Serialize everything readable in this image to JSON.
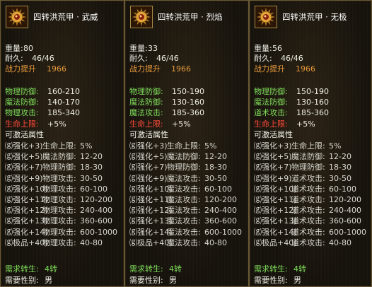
{
  "panels": [
    {
      "name": "四转洪荒甲 · 武威",
      "weight_label": "重量:",
      "weight": "80",
      "durability_label": "耐久:",
      "durability": "46/46",
      "power_label": "战力提升",
      "power": "1966",
      "stats": [
        {
          "label": "物理防御:",
          "value": "160-210"
        },
        {
          "label": "魔法防御:",
          "value": "140-170"
        },
        {
          "label": "物理攻击:",
          "value": "185-340"
        }
      ],
      "hp_label": "生命上限:",
      "hp_value": "+5%",
      "activate_title": "可激活属性",
      "activate": [
        {
          "level": "⒢强化+3)",
          "attr": "生命上限:",
          "value": "5%"
        },
        {
          "level": "⒢强化+5)",
          "attr": "魔法防御:",
          "value": "12-20"
        },
        {
          "level": "⒢强化+7)",
          "attr": "物理防御:",
          "value": "18-30"
        },
        {
          "level": "⒢强化+9)",
          "attr": "物理攻击:",
          "value": "30-50"
        },
        {
          "level": "⒢强化+10)",
          "attr": "物理攻击:",
          "value": "60-100"
        },
        {
          "level": "⒢强化+11)",
          "attr": "物理攻击:",
          "value": "120-200"
        },
        {
          "level": "⒢强化+12)",
          "attr": "物理攻击:",
          "value": "240-400"
        },
        {
          "level": "⒢强化+13)",
          "attr": "物理攻击:",
          "value": "360-600"
        },
        {
          "level": "⒢强化+14)",
          "attr": "物理攻击:",
          "value": "600-1000"
        },
        {
          "level": "⒢极品+40)",
          "attr": "物理攻击:",
          "value": "40-80"
        }
      ],
      "req_rebirth_label": "需求转生:",
      "req_rebirth": "4转",
      "req_gender_label": "需要性别:",
      "req_gender": "男"
    },
    {
      "name": "四转洪荒甲 · 烈焰",
      "weight_label": "重量:",
      "weight": "33",
      "durability_label": "耐久:",
      "durability": "46/46",
      "power_label": "战力提升",
      "power": "1966",
      "stats": [
        {
          "label": "物理防御:",
          "value": "150-190"
        },
        {
          "label": "魔法防御:",
          "value": "130-160"
        },
        {
          "label": "魔法攻击:",
          "value": "185-360"
        }
      ],
      "hp_label": "生命上限:",
      "hp_value": "+5%",
      "activate_title": "可激活属性",
      "activate": [
        {
          "level": "⒢强化+3)",
          "attr": "生命上限:",
          "value": "5%"
        },
        {
          "level": "⒢强化+5)",
          "attr": "魔法防御:",
          "value": "12-20"
        },
        {
          "level": "⒢强化+7)",
          "attr": "物理防御:",
          "value": "18-30"
        },
        {
          "level": "⒢强化+9)",
          "attr": "魔法攻击:",
          "value": "30-50"
        },
        {
          "level": "⒢强化+10)",
          "attr": "魔法攻击:",
          "value": "60-100"
        },
        {
          "level": "⒢强化+11)",
          "attr": "魔法攻击:",
          "value": "120-200"
        },
        {
          "level": "⒢强化+12)",
          "attr": "魔法攻击:",
          "value": "240-400"
        },
        {
          "level": "⒢强化+13)",
          "attr": "魔法攻击:",
          "value": "360-600"
        },
        {
          "level": "⒢强化+14)",
          "attr": "魔法攻击:",
          "value": "600-1000"
        },
        {
          "level": "⒢极品+40)",
          "attr": "魔法攻击:",
          "value": "40-80"
        }
      ],
      "req_rebirth_label": "需求转生:",
      "req_rebirth": "4转",
      "req_gender_label": "需要性别:",
      "req_gender": "男"
    },
    {
      "name": "四转洪荒甲 · 无极",
      "weight_label": "重量:",
      "weight": "56",
      "durability_label": "耐久:",
      "durability": "46/46",
      "power_label": "战力提升",
      "power": "1966",
      "stats": [
        {
          "label": "物理防御:",
          "value": "150-190"
        },
        {
          "label": "魔法防御:",
          "value": "130-160"
        },
        {
          "label": "道术攻击:",
          "value": "185-360"
        }
      ],
      "hp_label": "生命上限:",
      "hp_value": "+5%",
      "activate_title": "可激活属性",
      "activate": [
        {
          "level": "⒢强化+3)",
          "attr": "生命上限:",
          "value": "5%"
        },
        {
          "level": "⒢强化+5)",
          "attr": "魔法防御:",
          "value": "12-20"
        },
        {
          "level": "⒢强化+7)",
          "attr": "物理防御:",
          "value": "18-30"
        },
        {
          "level": "⒢强化+9)",
          "attr": "道术攻击:",
          "value": "30-50"
        },
        {
          "level": "⒢强化+10)",
          "attr": "道术攻击:",
          "value": "60-100"
        },
        {
          "level": "⒢强化+11)",
          "attr": "道术攻击:",
          "value": "120-200"
        },
        {
          "level": "⒢强化+12)",
          "attr": "道术攻击:",
          "value": "240-400"
        },
        {
          "level": "⒢强化+13)",
          "attr": "道术攻击:",
          "value": "360-600"
        },
        {
          "level": "⒢强化+14)",
          "attr": "道术攻击:",
          "value": "600-1000"
        },
        {
          "level": "⒢极品+40)",
          "attr": "道术攻击:",
          "value": "40-80"
        }
      ],
      "req_rebirth_label": "需求转生:",
      "req_rebirth": "4转",
      "req_gender_label": "需要性别:",
      "req_gender": "男"
    }
  ],
  "icon": "armor-medallion-icon",
  "colors": {
    "name": "#ffffff",
    "base": "#efefe4",
    "power": "#e89a3c",
    "stat": "#7fdd5a",
    "hp": "#ff4a3a",
    "border": "#6a5a34",
    "background": "#17130c"
  }
}
